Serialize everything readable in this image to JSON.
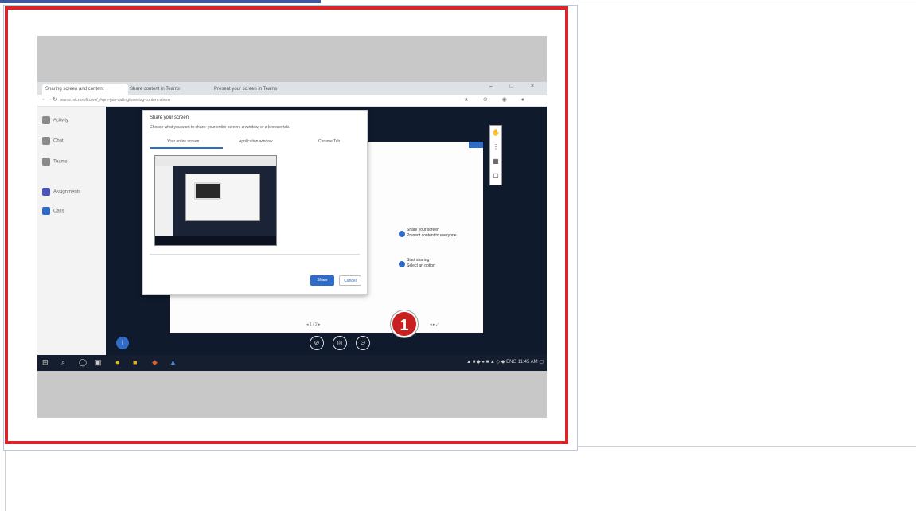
{
  "step": {
    "number": "1"
  },
  "browser": {
    "tabs": [
      "Sharing screen and content",
      "Share content in Teams",
      "Present your screen in Teams"
    ],
    "window_controls": "– □ ×",
    "nav_glyphs": [
      "←",
      "→",
      "↻"
    ],
    "url": "teams.microsoft.com/_#/pre-join-calling/meeting-content-share",
    "ext_icons": "★ ⊕ ◉ ●"
  },
  "teams_sidebar": {
    "items": [
      {
        "label": "Activity",
        "color": "#8a8a8a"
      },
      {
        "label": "Chat",
        "color": "#8a8a8a"
      },
      {
        "label": "Teams",
        "color": "#8a8a8a"
      },
      {
        "label": "Assignments",
        "color": "#4b53bc"
      },
      {
        "label": "Calls",
        "color": "#2f6cc8"
      }
    ]
  },
  "dialog": {
    "title": "Share your screen",
    "description": "Choose what you want to share: your entire screen, a window, or a browser tab.",
    "tabs": [
      "Your entire screen",
      "Application window",
      "Chrome Tab"
    ],
    "share_label": "Share",
    "cancel_label": "Cancel"
  },
  "slide": {
    "items": [
      {
        "title": "Share your screen",
        "sub": "Present content to everyone"
      },
      {
        "title": "Start sharing",
        "sub": "Select an option"
      }
    ]
  },
  "side_tools": [
    "✋",
    "⋮",
    "▦",
    "▢"
  ],
  "call_controls": [
    "⊘",
    "◎",
    "⊙"
  ],
  "info_glyph": "i",
  "pager": {
    "left": "◂  1 / 2  ▸",
    "right": "◂  ▸  ⤢"
  },
  "taskbar": {
    "glyphs": [
      "⊞",
      "⌕",
      "◯",
      "▣",
      "●",
      "■",
      "◆",
      "▲"
    ],
    "tray": "▲ ■ ◆ ● ■ ▲ ◇ ◆ ENG 11:45 AM  ▢"
  }
}
